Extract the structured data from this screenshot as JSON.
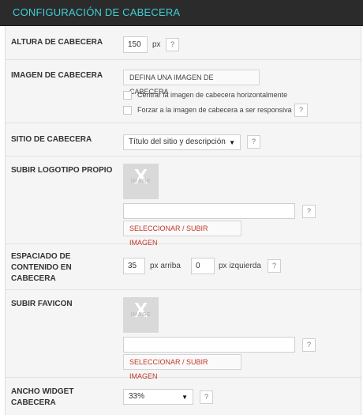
{
  "header": {
    "title": "CONFIGURACIÓN DE CABECERA"
  },
  "altura": {
    "label": "ALTURA DE CABECERA",
    "value": "150",
    "unit": "px",
    "help": "?"
  },
  "imagen": {
    "label": "IMAGEN DE CABECERA",
    "button": "DEFINA UNA IMAGEN DE CABECERA",
    "center_label": "Centrar la imagen de cabecera horizontalmente",
    "responsive_label": "Forzar a la imagen de cabecera a ser responsiva",
    "help": "?"
  },
  "sitio": {
    "label": "SITIO DE CABECERA",
    "selected": "Título del sitio y descripción",
    "help": "?"
  },
  "logotipo": {
    "label": "SUBIR LOGOTIPO PROPIO",
    "thumb_x": "X",
    "thumb_text": "IMAGE",
    "input_value": "",
    "help": "?",
    "button": "SELECCIONAR / SUBIR IMAGEN"
  },
  "espaciado": {
    "label_line1": "ESPACIADO DE",
    "label_line2": "CONTENIDO EN",
    "label_line3": "CABECERA",
    "top_value": "35",
    "top_unit": "px arriba",
    "left_value": "0",
    "left_unit": "px izquierda",
    "help": "?"
  },
  "favicon": {
    "label": "SUBIR FAVICON",
    "thumb_x": "X",
    "thumb_text": "IMAGE",
    "input_value": "",
    "help": "?",
    "button": "SELECCIONAR / SUBIR IMAGEN"
  },
  "ancho": {
    "label_line1": "ANCHO WIDGET",
    "label_line2": "CABECERA",
    "selected": "33%",
    "help": "?"
  }
}
